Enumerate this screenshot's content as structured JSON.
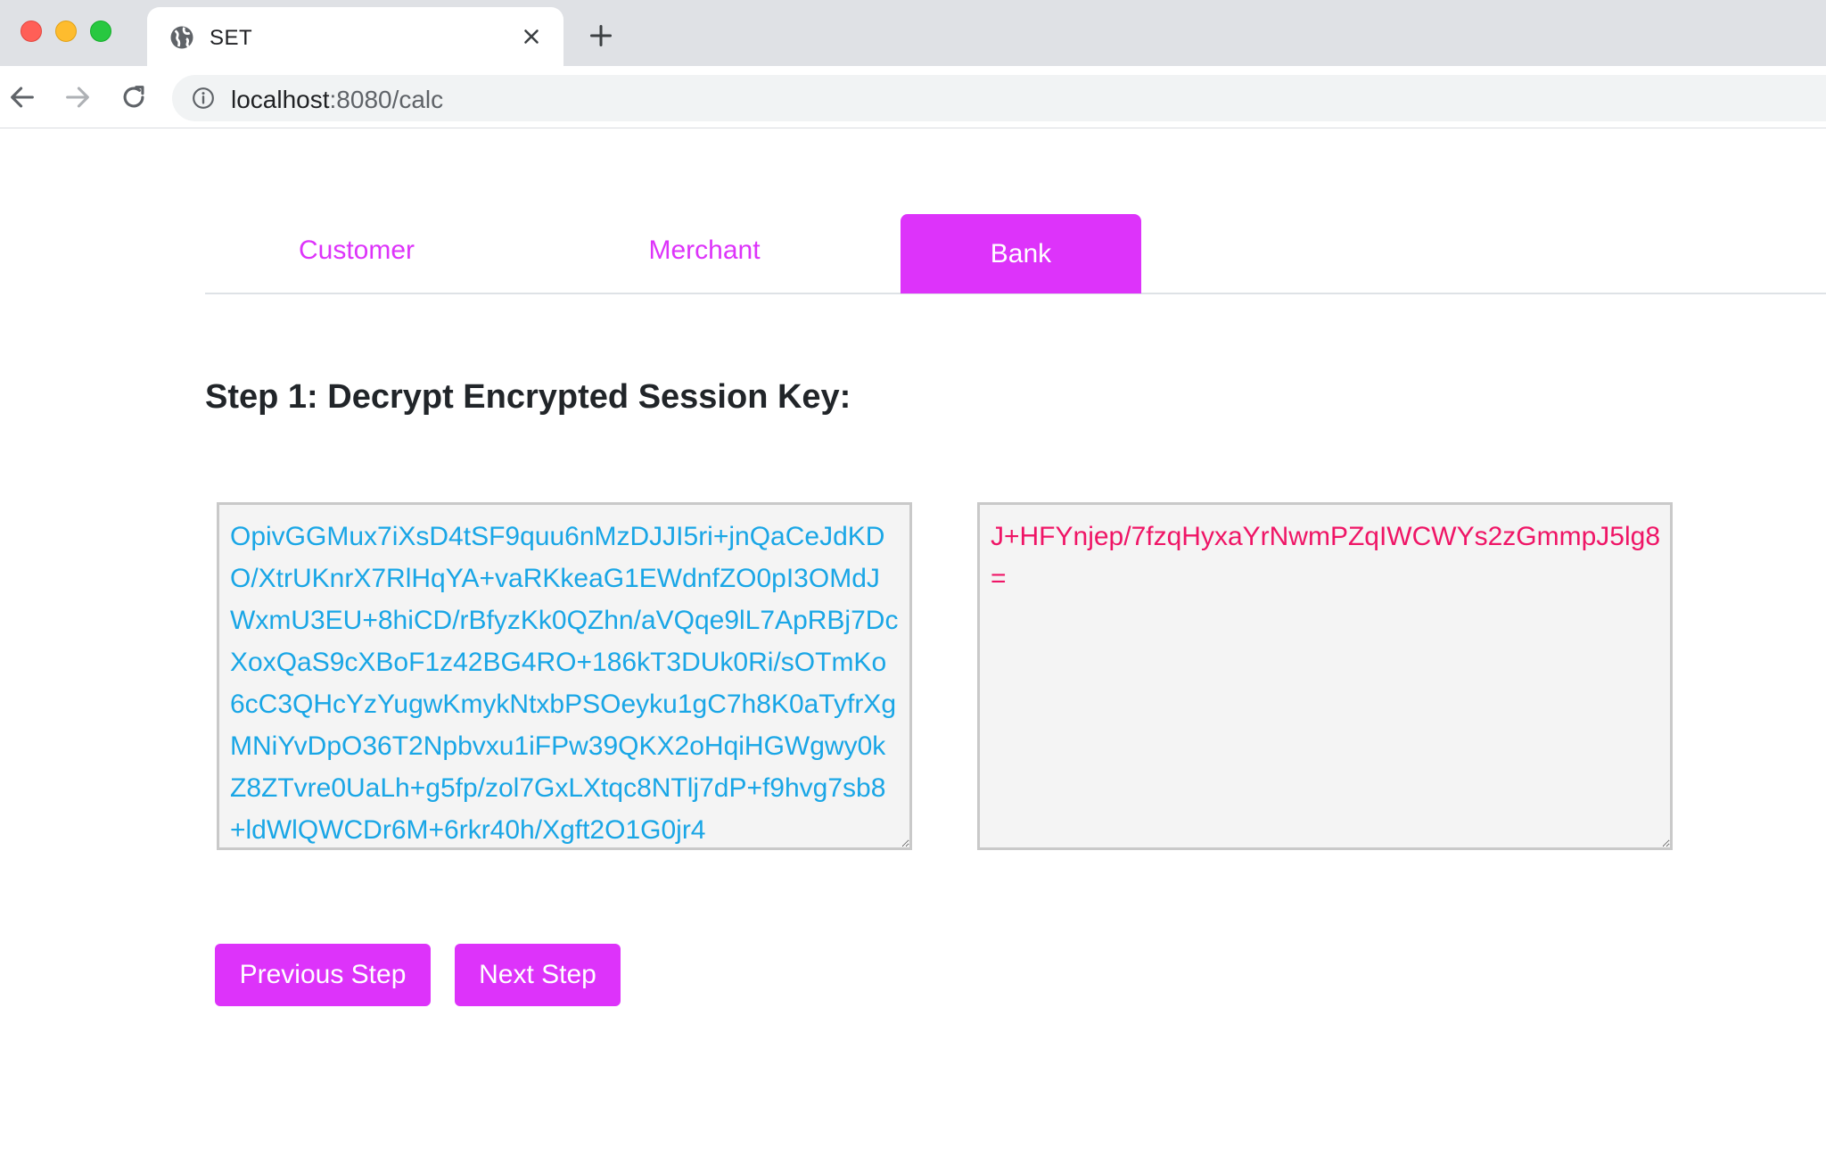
{
  "browser": {
    "tab_title": "SET",
    "url_host": "localhost",
    "url_rest": ":8080/calc"
  },
  "nav": {
    "tabs": [
      {
        "label": "Customer",
        "active": false
      },
      {
        "label": "Merchant",
        "active": false
      },
      {
        "label": "Bank",
        "active": true
      }
    ]
  },
  "step": {
    "title": "Step 1: Decrypt Encrypted Session Key:"
  },
  "encrypted_key": {
    "value": "OpivGGMux7iXsD4tSF9quu6nMzDJJI5ri+jnQaCeJdKDO/XtrUKnrX7RlHqYA+vaRKkeaG1EWdnfZO0pI3OMdJWxmU3EU+8hiCD/rBfyzKk0QZhn/aVQqe9lL7ApRBj7DcXoxQaS9cXBoF1z42BG4RO+186kT3DUk0Ri/sOTmKo6cC3QHcYzYugwKmykNtxbPSOeyku1gC7h8K0aTyfrXgMNiYvDpO36T2Npbvxu1iFPw39QKX2oHqiHGWgwy0kZ8ZTvre0UaLh+g5fp/zol7GxLXtqc8NTlj7dP+f9hvg7sb8+ldWlQWCDr6M+6rkr40h/Xgft2O1G0jr4"
  },
  "session_key": {
    "value": "J+HFYnjep/7fzqHyxaYrNwmPZqIWCWYs2zGmmpJ5lg8="
  },
  "buttons": {
    "previous": "Previous Step",
    "next": "Next Step"
  },
  "colors": {
    "accent": "#dd33fa",
    "encrypted_text": "#19a6e6",
    "session_key_text": "#ef1566"
  }
}
